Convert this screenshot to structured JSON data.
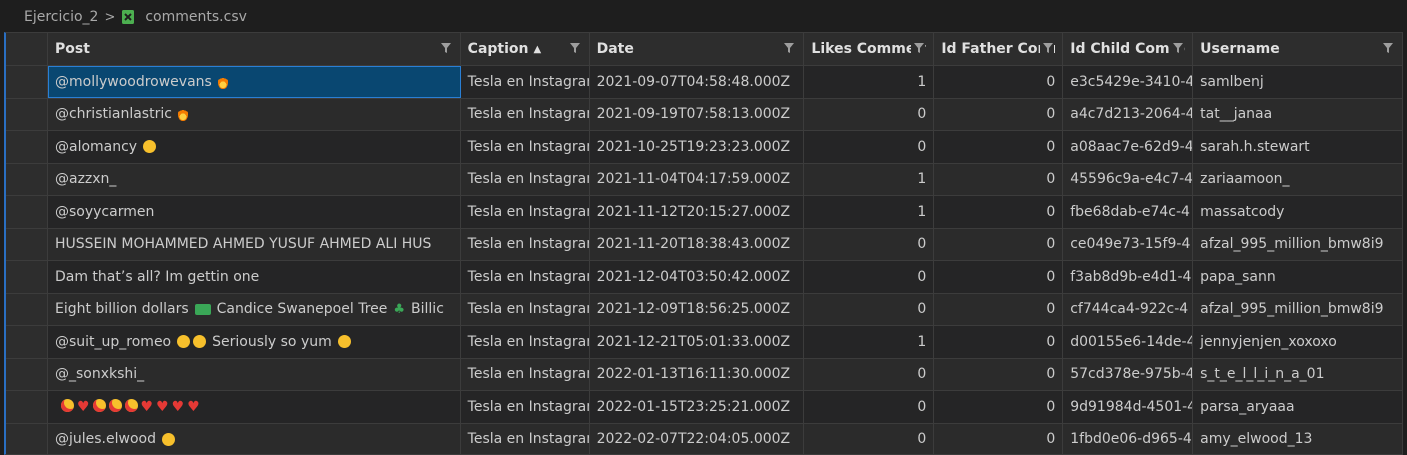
{
  "breadcrumb": {
    "folder": "Ejercicio_2",
    "separator": ">",
    "file": "comments.csv"
  },
  "columns": [
    {
      "label": "Post",
      "sorted": false
    },
    {
      "label": "Caption",
      "sorted": true,
      "sort_direction": "ascending"
    },
    {
      "label": "Date",
      "sorted": false
    },
    {
      "label": "Likes Comment",
      "sorted": false
    },
    {
      "label": "Id Father Comm",
      "sorted": false
    },
    {
      "label": "Id Child Comme",
      "sorted": false
    },
    {
      "label": "Username",
      "sorted": false
    }
  ],
  "rows": [
    {
      "post": "@mollywoodrowevans",
      "post_emoji": [
        "flame"
      ],
      "caption": "Tesla en Instagram",
      "date": "2021-09-07T04:58:48.000Z",
      "likes": "1",
      "father": "0",
      "child": "e3c5429e-3410-4",
      "username": "samlbenj"
    },
    {
      "post": "@christianlastric",
      "post_emoji": [
        "flame"
      ],
      "caption": "Tesla en Instagram",
      "date": "2021-09-19T07:58:13.000Z",
      "likes": "0",
      "father": "0",
      "child": "a4c7d213-2064-4",
      "username": "tat__janaa"
    },
    {
      "post": "@alomancy",
      "post_emoji": [
        "laughing-face"
      ],
      "caption": "Tesla en Instagram",
      "date": "2021-10-25T19:23:23.000Z",
      "likes": "0",
      "father": "0",
      "child": "a08aac7e-62d9-4",
      "username": "sarah.h.stewart"
    },
    {
      "post": "@azzxn_",
      "post_emoji": [],
      "caption": "Tesla en Instagram",
      "date": "2021-11-04T04:17:59.000Z",
      "likes": "1",
      "father": "0",
      "child": "45596c9a-e4c7-4",
      "username": "zariaamoon_"
    },
    {
      "post": "@soyycarmen",
      "post_emoji": [],
      "caption": "Tesla en Instagram",
      "date": "2021-11-12T20:15:27.000Z",
      "likes": "1",
      "father": "0",
      "child": "fbe68dab-e74c-4",
      "username": "massatcody"
    },
    {
      "post": "HUSSEIN MOHAMMED AHMED YUSUF AHMED ALI HUS",
      "post_emoji": [],
      "caption": "Tesla en Instagram",
      "date": "2021-11-20T18:38:43.000Z",
      "likes": "0",
      "father": "0",
      "child": "ce049e73-15f9-4",
      "username": "afzal_995_million_bmw8i9"
    },
    {
      "post": "Dam that’s all? Im gettin one",
      "post_emoji": [],
      "caption": "Tesla en Instagram",
      "date": "2021-12-04T03:50:42.000Z",
      "likes": "0",
      "father": "0",
      "child": "f3ab8d9b-e4d1-4",
      "username": "papa_sann"
    },
    {
      "post": "Eight billion dollars",
      "post_emoji": [
        "money"
      ],
      "post_tail": "Candice Swanepoel Tree",
      "post_tail_emoji": [
        "tree"
      ],
      "post_tail2": "Billic",
      "caption": "Tesla en Instagram",
      "date": "2021-12-09T18:56:25.000Z",
      "likes": "0",
      "father": "0",
      "child": "cf744ca4-922c-4",
      "username": "afzal_995_million_bmw8i9"
    },
    {
      "post": "@suit_up_romeo",
      "post_emoji": [
        "yum-face",
        "yum-face"
      ],
      "post_tail": "Seriously so yum",
      "post_tail_emoji": [
        "yum-face"
      ],
      "caption": "Tesla en Instagram",
      "date": "2021-12-21T05:01:33.000Z",
      "likes": "1",
      "father": "0",
      "child": "d00155e6-14de-4",
      "username": "jennyjenjen_xoxoxo"
    },
    {
      "post": "@_sonxkshi_",
      "post_emoji": [],
      "caption": "Tesla en Instagram",
      "date": "2022-01-13T16:11:30.000Z",
      "likes": "0",
      "father": "0",
      "child": "57cd378e-975b-4",
      "username": "s_t_e_l_l_i_n_a_01"
    },
    {
      "post": "",
      "post_emoji": [
        "star-eyes-face",
        "heart",
        "star-eyes-face",
        "star-eyes-face",
        "star-eyes-face",
        "heart",
        "heart",
        "heart",
        "heart"
      ],
      "caption": "Tesla en Instagram",
      "date": "2022-01-15T23:25:21.000Z",
      "likes": "0",
      "father": "0",
      "child": "9d91984d-4501-4",
      "username": "parsa_aryaaa"
    },
    {
      "post": "@jules.elwood",
      "post_emoji": [
        "laughing-face"
      ],
      "caption": "Tesla en Instagram",
      "date": "2022-02-07T22:04:05.000Z",
      "likes": "0",
      "father": "0",
      "child": "1fbd0e06-d965-4",
      "username": "amy_elwood_13"
    }
  ],
  "colors": {
    "background": "#1e1e1e",
    "header": "#2d2d2d",
    "selection": "#094771",
    "csv_icon": "#4caf50"
  }
}
